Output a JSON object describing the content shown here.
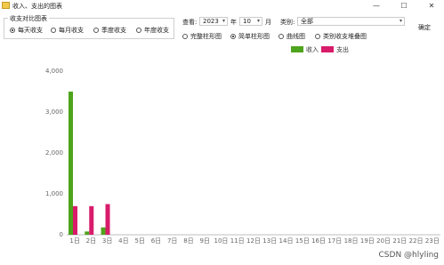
{
  "window": {
    "title": "收入、支出的图表",
    "minimize": "—",
    "maximize": "☐",
    "close": "✕"
  },
  "range_group": {
    "legend": "收支对比图表",
    "options": [
      {
        "label": "每天收支",
        "checked": true
      },
      {
        "label": "每月收支",
        "checked": false
      },
      {
        "label": "季度收支",
        "checked": false
      },
      {
        "label": "年度收支",
        "checked": false
      }
    ]
  },
  "filters": {
    "view_label": "查看:",
    "year_value": "2023",
    "year_unit": "年",
    "month_value": "10",
    "month_unit": "月",
    "category_label": "类别:",
    "category_value": "全部",
    "confirm_label": "确定"
  },
  "chart_types": [
    {
      "label": "完整柱形图",
      "checked": false
    },
    {
      "label": "简单柱形图",
      "checked": true
    },
    {
      "label": "曲线图",
      "checked": false
    },
    {
      "label": "类别收支堆叠图",
      "checked": false
    }
  ],
  "chart_data": {
    "type": "bar",
    "categories": [
      "1日",
      "2日",
      "3日",
      "4日",
      "5日",
      "6日",
      "7日",
      "8日",
      "9日",
      "10日",
      "11日",
      "12日",
      "13日",
      "14日",
      "15日",
      "16日",
      "17日",
      "18日",
      "19日",
      "20日",
      "21日",
      "22日",
      "23日"
    ],
    "series": [
      {
        "name": "收入",
        "color": "#4ea41c",
        "values": [
          3500,
          80,
          180,
          0,
          0,
          0,
          0,
          0,
          0,
          0,
          0,
          0,
          0,
          0,
          0,
          0,
          0,
          0,
          0,
          0,
          0,
          0,
          0
        ]
      },
      {
        "name": "支出",
        "color": "#d81b6a",
        "values": [
          700,
          700,
          750,
          0,
          0,
          0,
          0,
          0,
          0,
          0,
          0,
          0,
          0,
          0,
          0,
          0,
          0,
          0,
          0,
          0,
          0,
          0,
          0
        ]
      }
    ],
    "ylim": [
      0,
      4000
    ],
    "yticks": [
      "0",
      "1,000",
      "2,000",
      "3,000",
      "4,000"
    ],
    "legend_position": "top-right"
  },
  "watermark": "CSDN @hlyling"
}
